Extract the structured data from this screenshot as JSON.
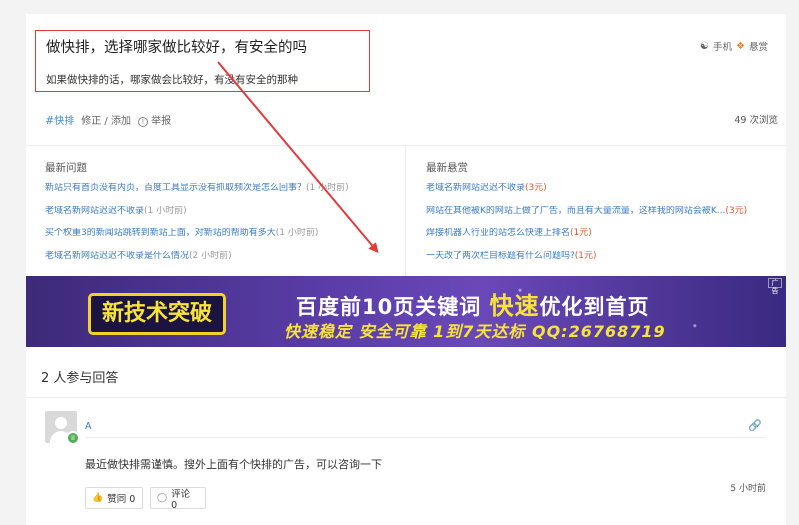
{
  "question": {
    "title": "做快排，选择哪家做比较好，有安全的吗",
    "description": "如果做快排的话，哪家做会比较好，有没有安全的那种",
    "tools": {
      "mobile": "手机",
      "reward": "悬赏"
    },
    "tag": "快排",
    "edit": "修正 / 添加",
    "report": "举报",
    "views": "49 次浏览"
  },
  "latest_questions": {
    "title": "最新问题",
    "items": [
      {
        "text": "新站只有首页没有内页，百度工具显示没有抓取频次是怎么回事？",
        "time": "(1 小时前)"
      },
      {
        "text": "老域名新网站迟迟不收录",
        "time": "(1 小时前)"
      },
      {
        "text": "买个权重3的新闻站跳转到新站上面，对新站的帮助有多大",
        "time": "(1 小时前)"
      },
      {
        "text": "老域名新网站迟迟不收录是什么情况",
        "time": "(2 小时前)"
      }
    ]
  },
  "latest_rewards": {
    "title": "最新悬赏",
    "items": [
      {
        "text": "老域名新网站迟迟不收录",
        "reward": "(3元)"
      },
      {
        "text": "网站在其他被K的网站上做了广告，而且有大量流量，这样我的网站会被K...",
        "reward": "(3元)"
      },
      {
        "text": "焊接机器人行业的站怎么快速上排名",
        "reward": "(1元)"
      },
      {
        "text": "一天改了两次栏目标题有什么问题吗?",
        "reward": "(1元)"
      }
    ]
  },
  "banner": {
    "badge": "新技术突破",
    "main_prefix": "百度前10页关键词",
    "main_fast": "快速",
    "main_suffix": "优化到首页",
    "sub": "快速稳定 安全可靠 1到7天达标 QQ:26768719",
    "corner": "广告"
  },
  "answers": {
    "count_label": "2 人参与回答",
    "items": [
      {
        "user": "A",
        "text": "最近做快排需谨慎。搜外上面有个快排的广告，可以咨询一下",
        "time": "5 小时前",
        "like_label": "赞同 0",
        "comment_label": "评论 0"
      }
    ]
  },
  "colors": {
    "highlight": "#e23b3b",
    "link": "#3a7bc8",
    "reward": "#e0572c"
  }
}
